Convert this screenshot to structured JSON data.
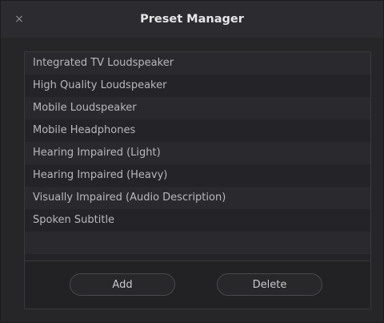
{
  "dialog": {
    "title": "Preset Manager",
    "close_glyph": "×"
  },
  "presets": [
    {
      "label": "Integrated TV Loudspeaker"
    },
    {
      "label": "High Quality Loudspeaker"
    },
    {
      "label": "Mobile Loudspeaker"
    },
    {
      "label": "Mobile Headphones"
    },
    {
      "label": "Hearing Impaired (Light)"
    },
    {
      "label": "Hearing Impaired (Heavy)"
    },
    {
      "label": "Visually Impaired (Audio Description)"
    },
    {
      "label": "Spoken Subtitle"
    }
  ],
  "buttons": {
    "add_label": "Add",
    "delete_label": "Delete"
  },
  "icons": {
    "close": "close-icon"
  },
  "colors": {
    "background": "#262629",
    "text": "#b9b9bd",
    "title": "#e6e6e8"
  }
}
